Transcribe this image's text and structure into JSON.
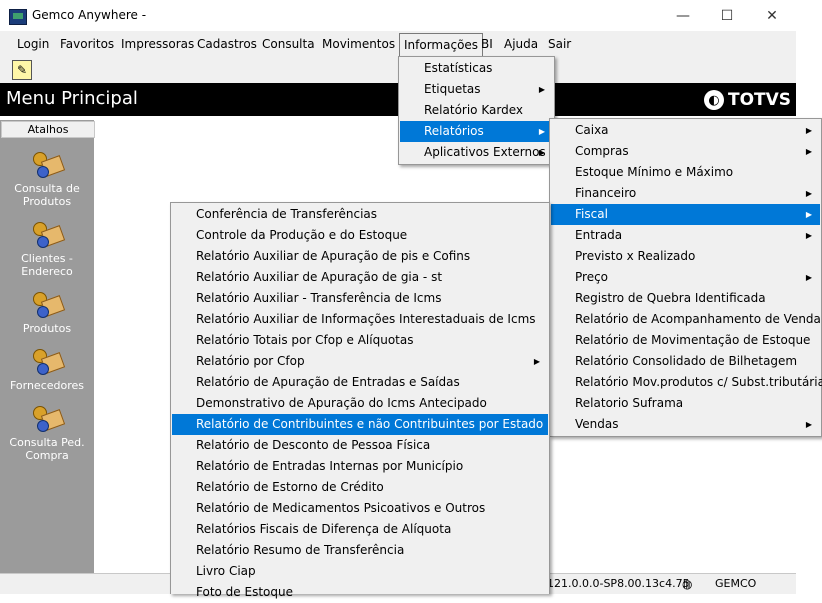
{
  "window": {
    "title": "Gemco Anywhere -",
    "minimize": "—",
    "maximize": "☐",
    "close": "✕"
  },
  "menubar": {
    "items": [
      "Login",
      "Favoritos",
      "Impressoras",
      "Cadastros",
      "Consulta",
      "Movimentos",
      "Informações",
      "BI",
      "Ajuda",
      "Sair"
    ],
    "active": "Informações"
  },
  "toolbar": {
    "icon": "help-icon"
  },
  "header": {
    "title": "Menu Principal",
    "brand": "TOTVS"
  },
  "sidebar": {
    "heading": "Atalhos",
    "items": [
      {
        "label1": "Consulta de",
        "label2": "Produtos"
      },
      {
        "label1": "Clientes -",
        "label2": "Endereco"
      },
      {
        "label1": "Produtos",
        "label2": ""
      },
      {
        "label1": "Fornecedores",
        "label2": ""
      },
      {
        "label1": "Consulta Ped.",
        "label2": "Compra"
      }
    ]
  },
  "informacoes_menu": {
    "items": [
      {
        "label": "Estatísticas",
        "submenu": false
      },
      {
        "label": "Etiquetas",
        "submenu": true
      },
      {
        "label": "Relatório Kardex",
        "submenu": false
      },
      {
        "label": "Relatórios",
        "submenu": true,
        "selected": true
      },
      {
        "label": "Aplicativos Externos",
        "submenu": true
      }
    ]
  },
  "relatorios_menu": {
    "items": [
      {
        "label": "Caixa",
        "submenu": true
      },
      {
        "label": "Compras",
        "submenu": true
      },
      {
        "label": "Estoque Mínimo e Máximo",
        "submenu": false
      },
      {
        "label": "Financeiro",
        "submenu": true
      },
      {
        "label": "Fiscal",
        "submenu": true,
        "selected": true
      },
      {
        "label": "Entrada",
        "submenu": true
      },
      {
        "label": "Previsto x Realizado",
        "submenu": false
      },
      {
        "label": "Preço",
        "submenu": true
      },
      {
        "label": "Registro de Quebra Identificada",
        "submenu": false
      },
      {
        "label": "Relatório de Acompanhamento de Venda",
        "submenu": false
      },
      {
        "label": "Relatório de Movimentação de Estoque",
        "submenu": false
      },
      {
        "label": "Relatório Consolidado de Bilhetagem",
        "submenu": false
      },
      {
        "label": "Relatório Mov.produtos c/ Subst.tributária",
        "submenu": false
      },
      {
        "label": "Relatorio Suframa",
        "submenu": false
      },
      {
        "label": "Vendas",
        "submenu": true
      }
    ]
  },
  "fiscal_menu": {
    "items": [
      {
        "label": "Conferência de Transferências",
        "submenu": false
      },
      {
        "label": "Controle da Produção e do Estoque",
        "submenu": false
      },
      {
        "label": "Relatório Auxiliar de Apuração de pis e Cofins",
        "submenu": false
      },
      {
        "label": "Relatório Auxiliar de Apuração de  gia -  st",
        "submenu": false
      },
      {
        "label": "Relatório Auxiliar - Transferência de Icms",
        "submenu": false
      },
      {
        "label": "Relatório Auxiliar de Informações Interestaduais de Icms",
        "submenu": false
      },
      {
        "label": "Relatório Totais por Cfop e Alíquotas",
        "submenu": false
      },
      {
        "label": "Relatório por Cfop",
        "submenu": true
      },
      {
        "label": "Relatório de Apuração de Entradas e Saídas",
        "submenu": false
      },
      {
        "label": "Demonstrativo de Apuração do Icms Antecipado",
        "submenu": false
      },
      {
        "label": "Relatório de Contribuintes e não Contribuintes por Estado",
        "submenu": false,
        "selected": true
      },
      {
        "label": "Relatório de Desconto de Pessoa Física",
        "submenu": false
      },
      {
        "label": "Relatório de Entradas Internas por Município",
        "submenu": false
      },
      {
        "label": "Relatório de Estorno de Crédito",
        "submenu": false
      },
      {
        "label": "Relatório de Medicamentos Psicoativos e Outros",
        "submenu": false
      },
      {
        "label": "Relatórios Fiscais de Diferença de Alíquota",
        "submenu": false
      },
      {
        "label": "Relatório Resumo de Transferência",
        "submenu": false
      },
      {
        "label": "Livro Ciap",
        "submenu": false
      },
      {
        "label": "Foto de Estoque",
        "submenu": false
      }
    ]
  },
  "status": {
    "version": "121.0.0.0-SP8.00.13c4.75",
    "company": "GEMCO"
  }
}
